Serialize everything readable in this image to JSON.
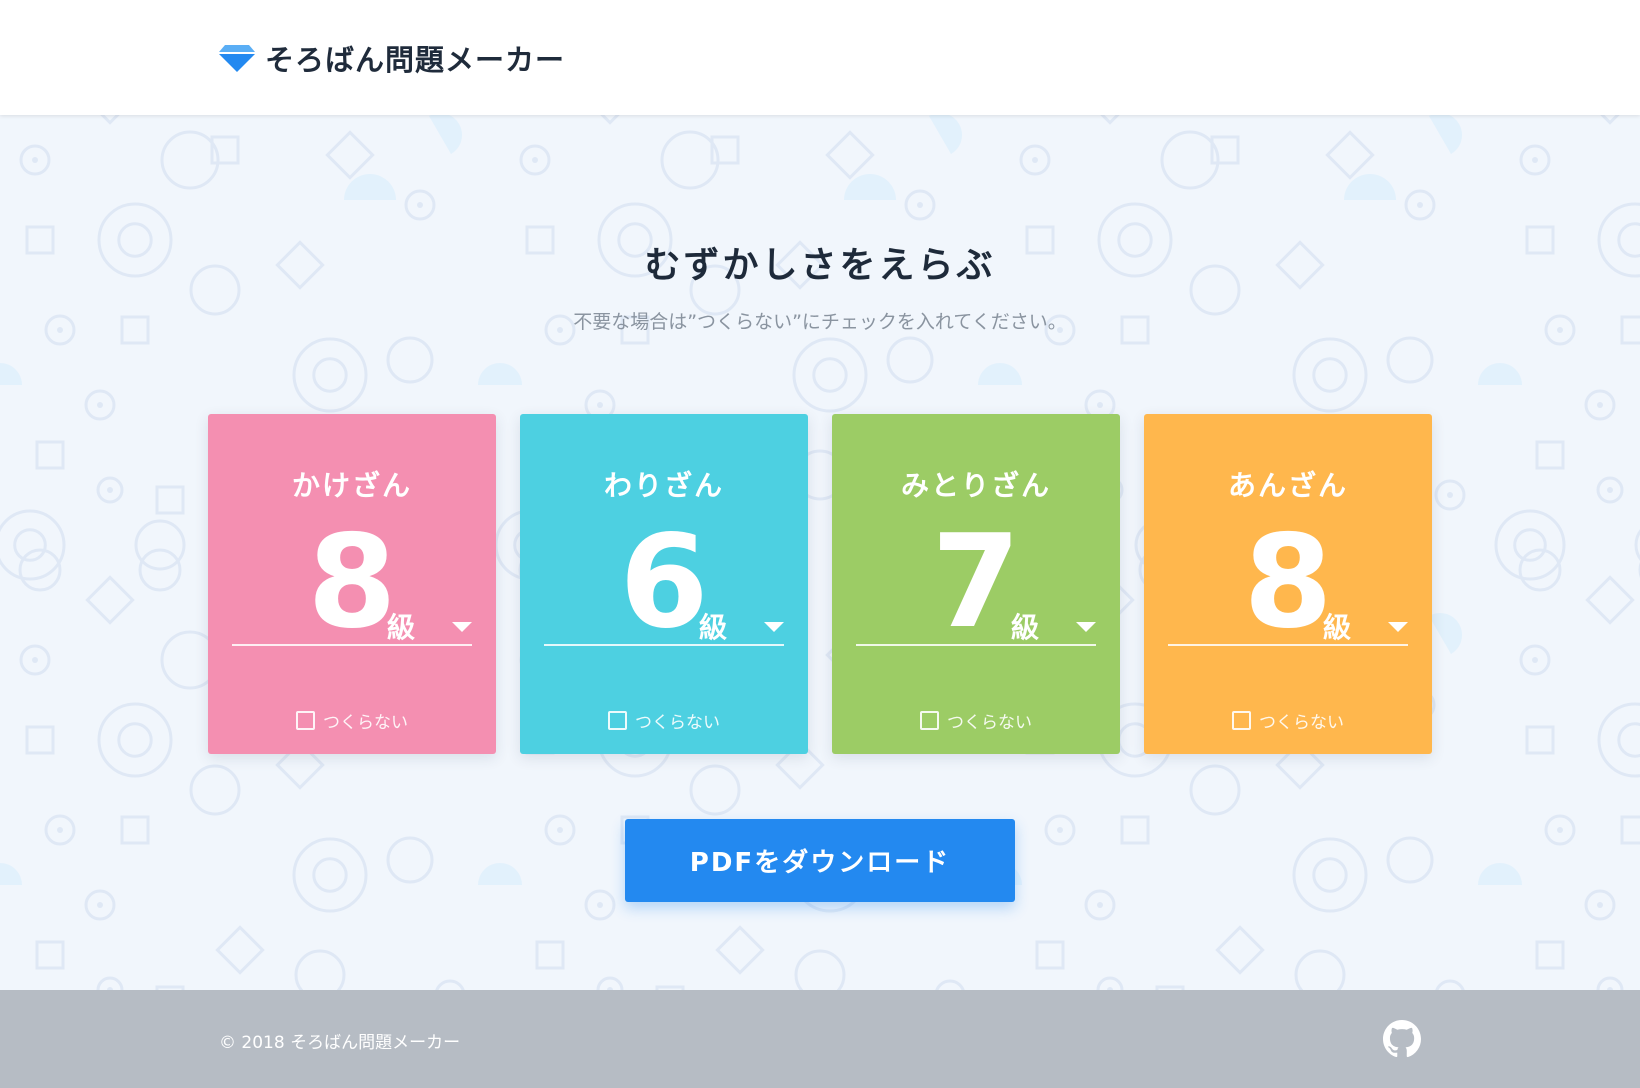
{
  "header": {
    "title": "そろばん問題メーカー",
    "logo_icon": "diamond-icon"
  },
  "main": {
    "title": "むずかしさをえらぶ",
    "subtitle": "不要な場合は”つくらない”にチェックを入れてください。",
    "cards": [
      {
        "label": "かけざん",
        "grade": "8",
        "unit": "級",
        "skip_label": "つくらない",
        "color": "#f48fb1"
      },
      {
        "label": "わりざん",
        "grade": "6",
        "unit": "級",
        "skip_label": "つくらない",
        "color": "#4dd0e1"
      },
      {
        "label": "みとりざん",
        "grade": "7",
        "unit": "級",
        "skip_label": "つくらない",
        "color": "#9ccc65"
      },
      {
        "label": "あんざん",
        "grade": "8",
        "unit": "級",
        "skip_label": "つくらない",
        "color": "#ffb74d"
      }
    ],
    "download_label": "PDFをダウンロード",
    "button_color": "#2389f0"
  },
  "footer": {
    "copyright": "© 2018 そろばん問題メーカー",
    "github_icon": "github-icon",
    "background": "#b6bcc4"
  }
}
